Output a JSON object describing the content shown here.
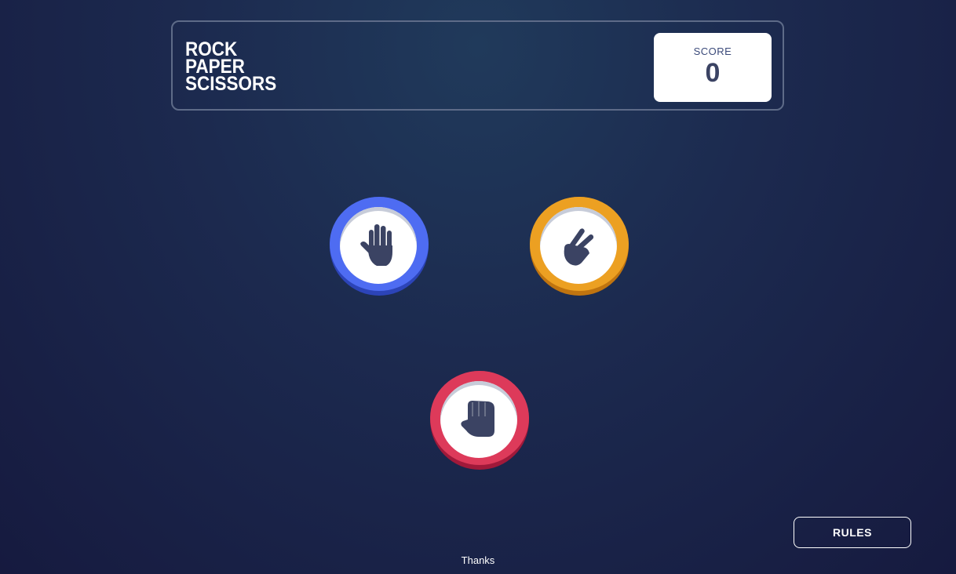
{
  "title_lines": [
    "ROCK",
    "PAPER",
    "SCISSORS"
  ],
  "score": {
    "label": "SCORE",
    "value": "0"
  },
  "choices": [
    {
      "name": "paper",
      "icon": "paper-hand-icon",
      "color": "#4e6cf2"
    },
    {
      "name": "scissors",
      "icon": "scissors-hand-icon",
      "color": "#eca022"
    },
    {
      "name": "rock",
      "icon": "rock-fist-icon",
      "color": "#dd3a5a"
    }
  ],
  "rules_button": {
    "label": "RULES"
  },
  "footer": {
    "text": "Thanks"
  },
  "colors": {
    "background": "#1f2a4f",
    "icon": "#3b4363",
    "score_text": "#3b4363"
  }
}
